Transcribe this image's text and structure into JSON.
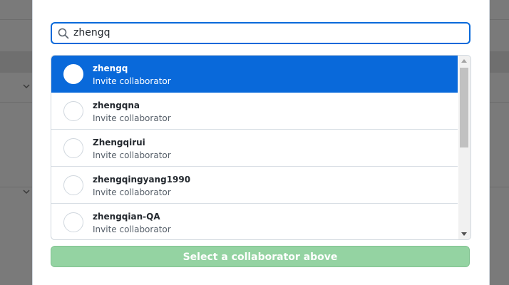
{
  "search": {
    "value": "zhengq",
    "icon": "search-icon"
  },
  "results": [
    {
      "name": "zhengq",
      "action": "Invite collaborator",
      "selected": true
    },
    {
      "name": "zhengqna",
      "action": "Invite collaborator",
      "selected": false
    },
    {
      "name": "Zhengqirui",
      "action": "Invite collaborator",
      "selected": false
    },
    {
      "name": "zhengqingyang1990",
      "action": "Invite collaborator",
      "selected": false
    },
    {
      "name": "zhengqian-QA",
      "action": "Invite collaborator",
      "selected": false
    }
  ],
  "submit_label": "Select a collaborator above",
  "colors": {
    "selected_bg": "#0969da",
    "focus_border": "#0969da",
    "submit_disabled": "#94d3a2"
  }
}
